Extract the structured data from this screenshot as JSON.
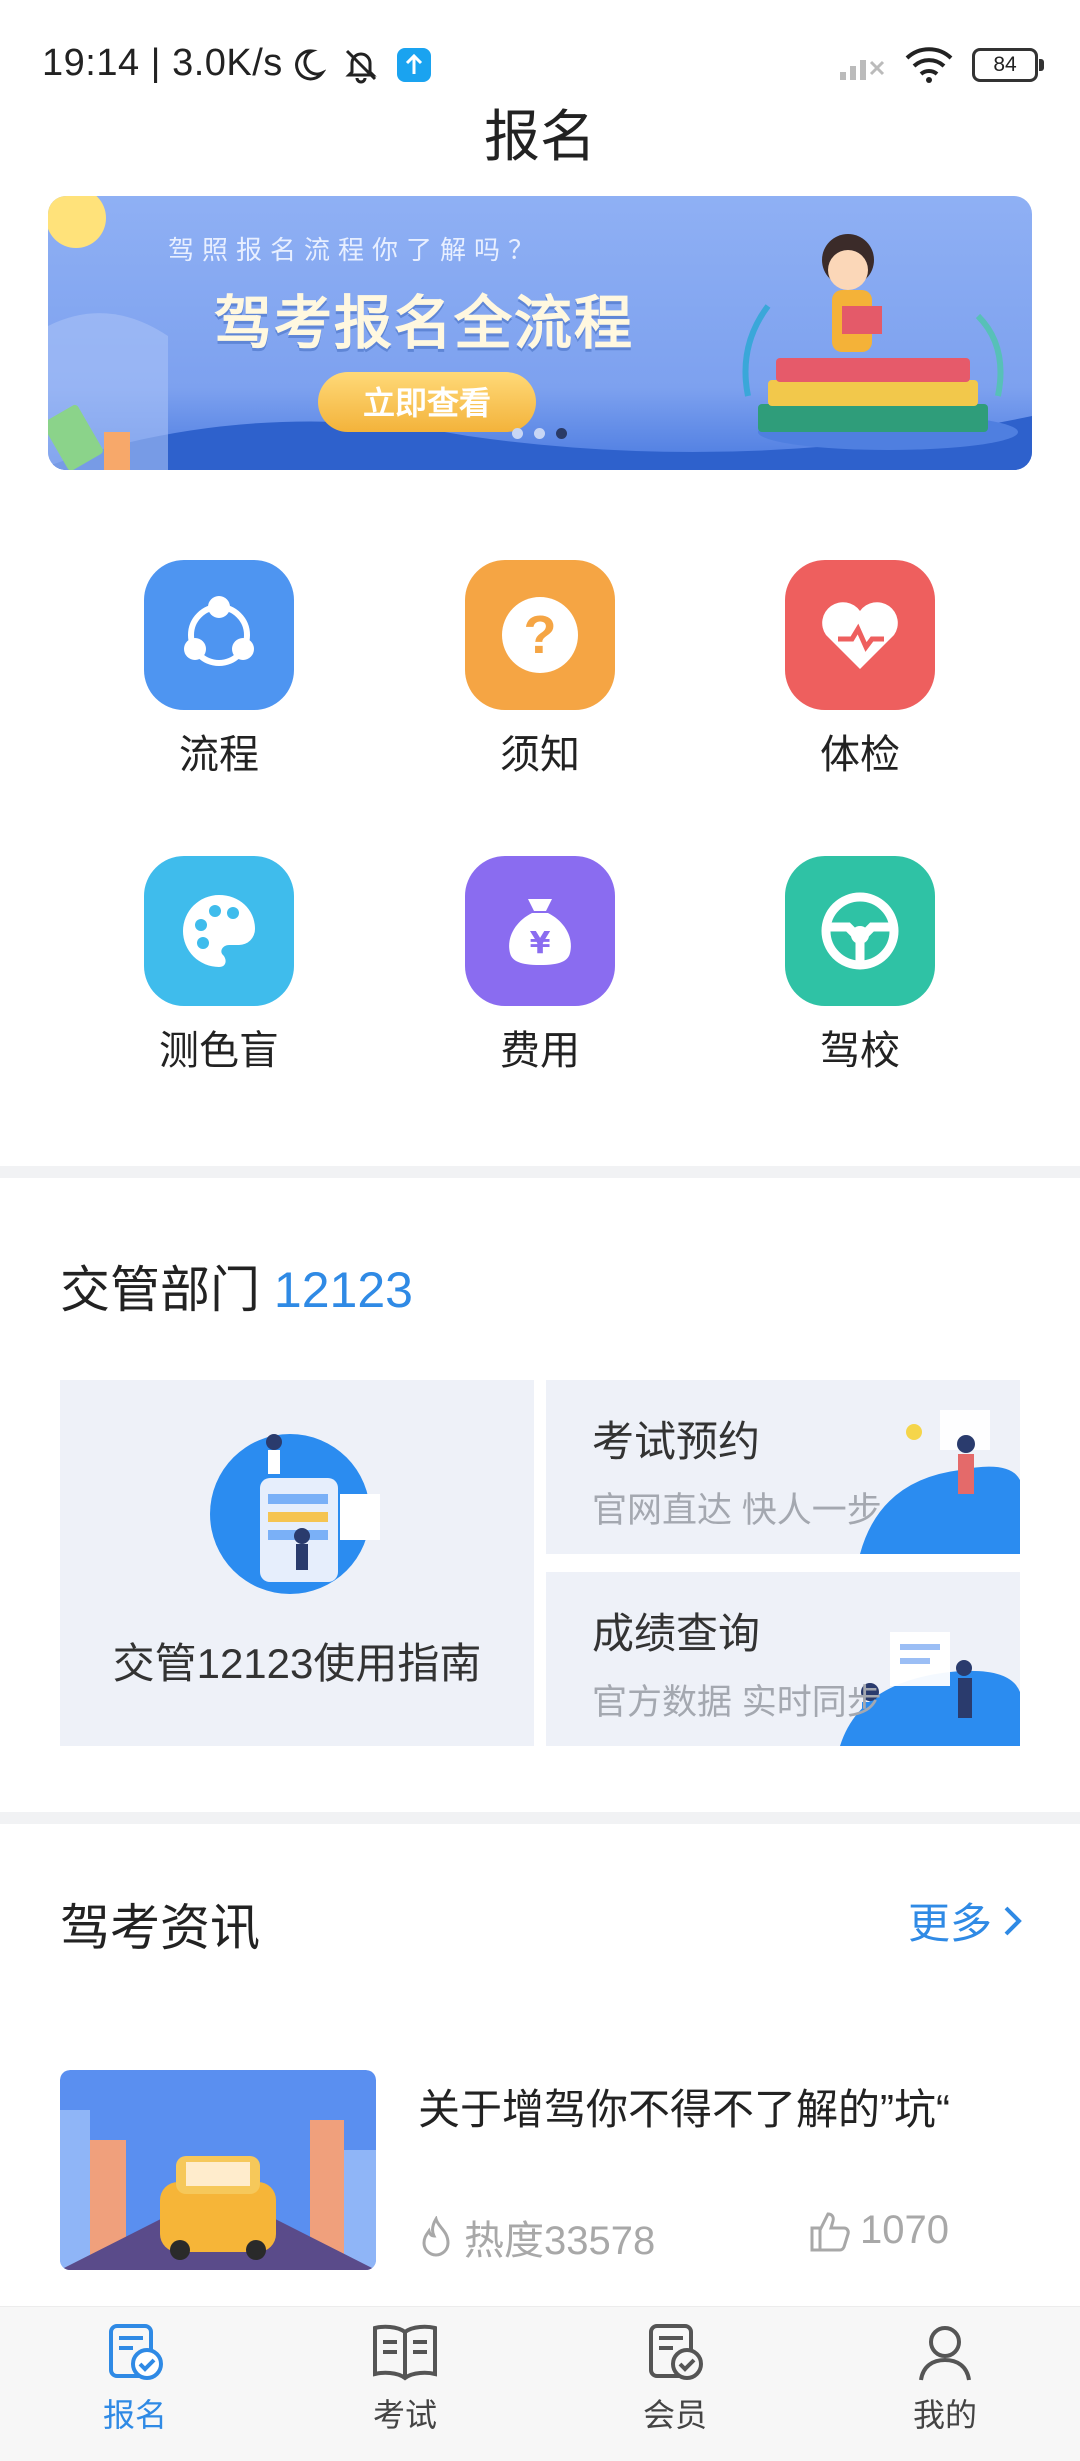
{
  "status_bar": {
    "time": "19:14 | 3.0K/s",
    "battery": "84"
  },
  "page": {
    "title": "报名"
  },
  "banner": {
    "subtitle": "驾照报名流程你了解吗？",
    "title": "驾考报名全流程",
    "button": "立即查看",
    "active_dot": 3
  },
  "grid": {
    "items": [
      {
        "label": "流程",
        "icon": "share-nodes-icon",
        "color": "#4e95f1"
      },
      {
        "label": "须知",
        "icon": "question-icon",
        "color": "#f5a544"
      },
      {
        "label": "体检",
        "icon": "heart-pulse-icon",
        "color": "#ee5f5e"
      },
      {
        "label": "测色盲",
        "icon": "palette-icon",
        "color": "#3fbcec"
      },
      {
        "label": "费用",
        "icon": "money-bag-icon",
        "color": "#8a6cf0"
      },
      {
        "label": "驾校",
        "icon": "steering-wheel-icon",
        "color": "#2fc2a5"
      }
    ]
  },
  "traffic": {
    "title": "交管部门",
    "title_accent": "12123",
    "guide": "交管12123使用指南",
    "cards": [
      {
        "title": "考试预约",
        "subtitle": "官网直达 快人一步"
      },
      {
        "title": "成绩查询",
        "subtitle": "官方数据 实时同步"
      }
    ]
  },
  "news": {
    "title": "驾考资讯",
    "more": "更多",
    "items": [
      {
        "title": "关于增驾你不得不了解的”坑“",
        "heat": "热度33578",
        "likes": "1070"
      }
    ]
  },
  "bottom_nav": {
    "items": [
      {
        "label": "报名",
        "icon": "signup-icon",
        "active": true
      },
      {
        "label": "考试",
        "icon": "book-icon",
        "active": false
      },
      {
        "label": "会员",
        "icon": "member-icon",
        "active": false
      },
      {
        "label": "我的",
        "icon": "profile-icon",
        "active": false
      }
    ],
    "active_color": "#2f8ae5",
    "inactive_color": "#444444"
  }
}
